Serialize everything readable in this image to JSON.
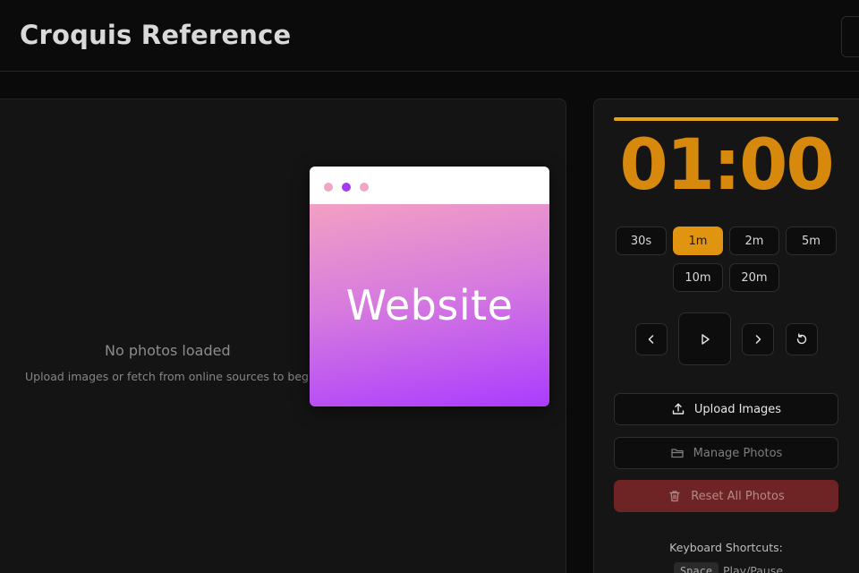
{
  "header": {
    "title": "Croquis Reference"
  },
  "photo_panel": {
    "empty_title": "No photos loaded",
    "empty_subtitle": "Upload images or fetch from online sources to begin"
  },
  "overlay_card": {
    "label": "Website"
  },
  "timer": {
    "display": "01:00",
    "progress": 1.0,
    "accent_color": "#e0940f",
    "durations": [
      {
        "label": "30s",
        "active": false
      },
      {
        "label": "1m",
        "active": true
      },
      {
        "label": "2m",
        "active": false
      },
      {
        "label": "5m",
        "active": false
      },
      {
        "label": "10m",
        "active": false
      },
      {
        "label": "20m",
        "active": false
      }
    ],
    "controls": [
      "chevron-left-icon",
      "play-icon",
      "chevron-right-icon",
      "reset-icon"
    ]
  },
  "actions": {
    "upload_label": "Upload Images",
    "manage_label": "Manage Photos",
    "reset_label": "Reset All Photos",
    "reset_color": "#6e2424"
  },
  "shortcuts": {
    "title": "Keyboard Shortcuts:",
    "items": [
      {
        "key": "Space",
        "action": "Play/Pause"
      }
    ]
  }
}
